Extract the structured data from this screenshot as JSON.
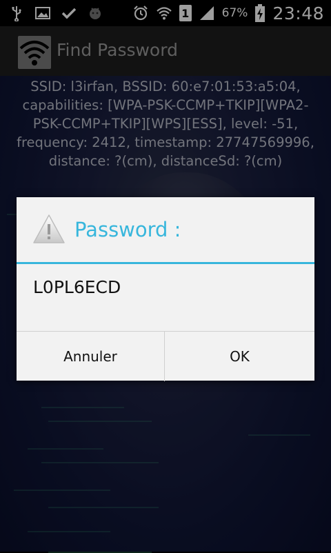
{
  "status_bar": {
    "left_icons": [
      "usb-icon",
      "image-icon",
      "check-icon",
      "android-icon"
    ],
    "right_icons": [
      "alarm-icon",
      "wifi-icon",
      "sim-1-icon",
      "signal-icon",
      "battery-charging-icon"
    ],
    "sim_label": "1",
    "battery": "67%",
    "time": "23:48"
  },
  "action_bar": {
    "title": "Find Password",
    "logo_icon": "wifi-logo-icon"
  },
  "wifi_info": "SSID: l3irfan, BSSID: 60:e7:01:53:a5:04, capabilities: [WPA-PSK-CCMP+TKIP][WPA2-PSK-CCMP+TKIP][WPS][ESS], level: -51, frequency: 2412, timestamp: 27747569996, distance: ?(cm), distanceSd: ?(cm)",
  "dialog": {
    "icon": "warning-icon",
    "title": "Password :",
    "message": "L0PL6ECD",
    "cancel_label": "Annuler",
    "ok_label": "OK"
  },
  "colors": {
    "accent": "#37b6dc",
    "dialog_bg": "#f2f2f2",
    "actionbar_bg": "#1d1d1d"
  }
}
